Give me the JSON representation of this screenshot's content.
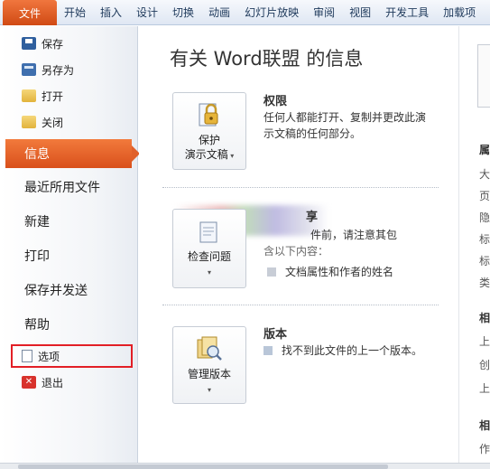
{
  "ribbon": {
    "file_tab": "文件",
    "tabs": [
      "开始",
      "插入",
      "设计",
      "切换",
      "动画",
      "幻灯片放映",
      "审阅",
      "视图",
      "开发工具",
      "加载项"
    ]
  },
  "nav": {
    "save": "保存",
    "save_as": "另存为",
    "open": "打开",
    "close": "关闭",
    "info": "信息",
    "recent": "最近所用文件",
    "new": "新建",
    "print": "打印",
    "save_send": "保存并发送",
    "help": "帮助",
    "options": "选项",
    "exit": "退出",
    "exit_glyph": "✕"
  },
  "main": {
    "title": "有关 Word联盟 的信息",
    "permissions": {
      "button_line1": "保护",
      "button_line2": "演示文稿",
      "heading": "权限",
      "text": "任何人都能打开、复制并更改此演示文稿的任何部分。"
    },
    "prepare": {
      "button_label": "检查问题",
      "heading_visible": "享",
      "text_partial": "件前，请注意其包",
      "text_partial2": "含以下内容：",
      "bullet": "文档属性和作者的姓名"
    },
    "versions": {
      "button_label": "管理版本",
      "heading": "版本",
      "text": "找不到此文件的上一个版本。"
    }
  },
  "right": {
    "chars": [
      "属",
      "大",
      "页",
      "隐",
      "标",
      "标",
      "类",
      "相",
      "上",
      "创",
      "上",
      "相",
      "作"
    ]
  },
  "colors": {
    "accent": "#d9501b",
    "highlight_box": "#e21f26"
  }
}
